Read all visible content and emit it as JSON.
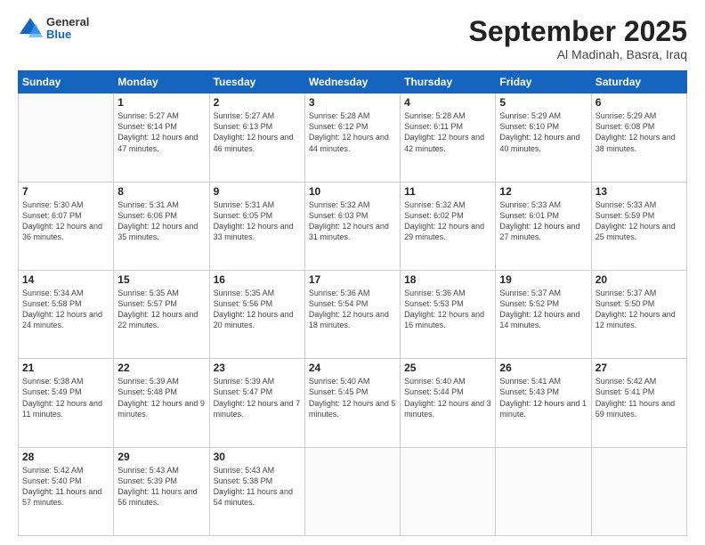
{
  "header": {
    "logo": {
      "general": "General",
      "blue": "Blue"
    },
    "month": "September 2025",
    "location": "Al Madinah, Basra, Iraq"
  },
  "weekdays": [
    "Sunday",
    "Monday",
    "Tuesday",
    "Wednesday",
    "Thursday",
    "Friday",
    "Saturday"
  ],
  "weeks": [
    [
      {
        "day": "",
        "info": ""
      },
      {
        "day": "1",
        "info": "Sunrise: 5:27 AM\nSunset: 6:14 PM\nDaylight: 12 hours\nand 47 minutes."
      },
      {
        "day": "2",
        "info": "Sunrise: 5:27 AM\nSunset: 6:13 PM\nDaylight: 12 hours\nand 46 minutes."
      },
      {
        "day": "3",
        "info": "Sunrise: 5:28 AM\nSunset: 6:12 PM\nDaylight: 12 hours\nand 44 minutes."
      },
      {
        "day": "4",
        "info": "Sunrise: 5:28 AM\nSunset: 6:11 PM\nDaylight: 12 hours\nand 42 minutes."
      },
      {
        "day": "5",
        "info": "Sunrise: 5:29 AM\nSunset: 6:10 PM\nDaylight: 12 hours\nand 40 minutes."
      },
      {
        "day": "6",
        "info": "Sunrise: 5:29 AM\nSunset: 6:08 PM\nDaylight: 12 hours\nand 38 minutes."
      }
    ],
    [
      {
        "day": "7",
        "info": "Sunrise: 5:30 AM\nSunset: 6:07 PM\nDaylight: 12 hours\nand 36 minutes."
      },
      {
        "day": "8",
        "info": "Sunrise: 5:31 AM\nSunset: 6:06 PM\nDaylight: 12 hours\nand 35 minutes."
      },
      {
        "day": "9",
        "info": "Sunrise: 5:31 AM\nSunset: 6:05 PM\nDaylight: 12 hours\nand 33 minutes."
      },
      {
        "day": "10",
        "info": "Sunrise: 5:32 AM\nSunset: 6:03 PM\nDaylight: 12 hours\nand 31 minutes."
      },
      {
        "day": "11",
        "info": "Sunrise: 5:32 AM\nSunset: 6:02 PM\nDaylight: 12 hours\nand 29 minutes."
      },
      {
        "day": "12",
        "info": "Sunrise: 5:33 AM\nSunset: 6:01 PM\nDaylight: 12 hours\nand 27 minutes."
      },
      {
        "day": "13",
        "info": "Sunrise: 5:33 AM\nSunset: 5:59 PM\nDaylight: 12 hours\nand 25 minutes."
      }
    ],
    [
      {
        "day": "14",
        "info": "Sunrise: 5:34 AM\nSunset: 5:58 PM\nDaylight: 12 hours\nand 24 minutes."
      },
      {
        "day": "15",
        "info": "Sunrise: 5:35 AM\nSunset: 5:57 PM\nDaylight: 12 hours\nand 22 minutes."
      },
      {
        "day": "16",
        "info": "Sunrise: 5:35 AM\nSunset: 5:56 PM\nDaylight: 12 hours\nand 20 minutes."
      },
      {
        "day": "17",
        "info": "Sunrise: 5:36 AM\nSunset: 5:54 PM\nDaylight: 12 hours\nand 18 minutes."
      },
      {
        "day": "18",
        "info": "Sunrise: 5:36 AM\nSunset: 5:53 PM\nDaylight: 12 hours\nand 16 minutes."
      },
      {
        "day": "19",
        "info": "Sunrise: 5:37 AM\nSunset: 5:52 PM\nDaylight: 12 hours\nand 14 minutes."
      },
      {
        "day": "20",
        "info": "Sunrise: 5:37 AM\nSunset: 5:50 PM\nDaylight: 12 hours\nand 12 minutes."
      }
    ],
    [
      {
        "day": "21",
        "info": "Sunrise: 5:38 AM\nSunset: 5:49 PM\nDaylight: 12 hours\nand 11 minutes."
      },
      {
        "day": "22",
        "info": "Sunrise: 5:39 AM\nSunset: 5:48 PM\nDaylight: 12 hours\nand 9 minutes."
      },
      {
        "day": "23",
        "info": "Sunrise: 5:39 AM\nSunset: 5:47 PM\nDaylight: 12 hours\nand 7 minutes."
      },
      {
        "day": "24",
        "info": "Sunrise: 5:40 AM\nSunset: 5:45 PM\nDaylight: 12 hours\nand 5 minutes."
      },
      {
        "day": "25",
        "info": "Sunrise: 5:40 AM\nSunset: 5:44 PM\nDaylight: 12 hours\nand 3 minutes."
      },
      {
        "day": "26",
        "info": "Sunrise: 5:41 AM\nSunset: 5:43 PM\nDaylight: 12 hours\nand 1 minute."
      },
      {
        "day": "27",
        "info": "Sunrise: 5:42 AM\nSunset: 5:41 PM\nDaylight: 11 hours\nand 59 minutes."
      }
    ],
    [
      {
        "day": "28",
        "info": "Sunrise: 5:42 AM\nSunset: 5:40 PM\nDaylight: 11 hours\nand 57 minutes."
      },
      {
        "day": "29",
        "info": "Sunrise: 5:43 AM\nSunset: 5:39 PM\nDaylight: 11 hours\nand 56 minutes."
      },
      {
        "day": "30",
        "info": "Sunrise: 5:43 AM\nSunset: 5:38 PM\nDaylight: 11 hours\nand 54 minutes."
      },
      {
        "day": "",
        "info": ""
      },
      {
        "day": "",
        "info": ""
      },
      {
        "day": "",
        "info": ""
      },
      {
        "day": "",
        "info": ""
      }
    ]
  ]
}
